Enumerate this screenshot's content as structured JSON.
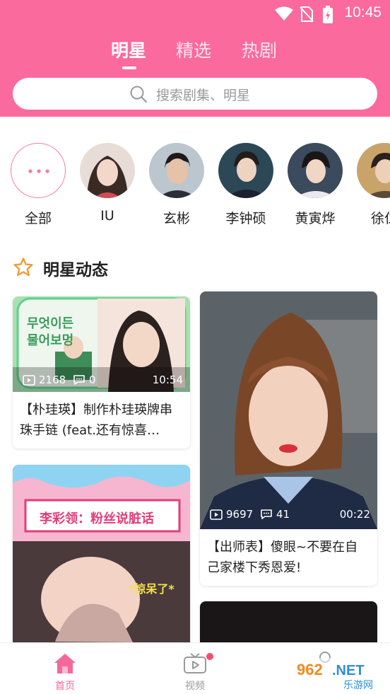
{
  "status": {
    "time": "10:45"
  },
  "tabs": [
    {
      "label": "明星"
    },
    {
      "label": "精选"
    },
    {
      "label": "热剧"
    }
  ],
  "search": {
    "placeholder": "搜索剧集、明星"
  },
  "stars": [
    {
      "name": "全部"
    },
    {
      "name": "IU"
    },
    {
      "name": "玄彬"
    },
    {
      "name": "李钟硕"
    },
    {
      "name": "黄寅烨"
    },
    {
      "name": "徐仁"
    }
  ],
  "section": {
    "title": "明星动态"
  },
  "cards": [
    {
      "thumb_text_1": "무엇이든",
      "thumb_text_2": "물어보멍",
      "views": "2168",
      "comments": "0",
      "duration": "10:54",
      "title": "【朴珪瑛】制作朴珪瑛牌串珠手链 (feat.还有惊喜…"
    },
    {
      "views": "9697",
      "comments": "41",
      "duration": "00:22",
      "title": "【出师表】傻眼~不要在自己家楼下秀恩爱!"
    },
    {
      "banner_text": "李彩领：粉丝说脏话",
      "caption": "*惊呆了*"
    }
  ],
  "bottom_nav": [
    {
      "label": "首页",
      "color": "#f6679a"
    },
    {
      "label": "视频",
      "color": "#9a9a9a"
    }
  ],
  "watermark": {
    "text_top": "962.NET",
    "text_bottom": "乐游网"
  },
  "colors": {
    "brand": "#fb6a9c",
    "accent": "#f6679a"
  }
}
